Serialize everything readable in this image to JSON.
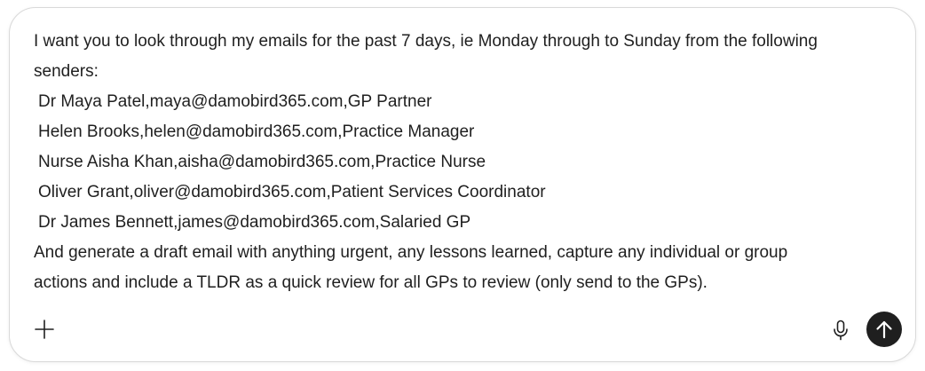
{
  "composer": {
    "prompt_lines": [
      "I want you to look through my emails for the past 7 days, ie Monday through to Sunday from the following",
      "senders:",
      "Dr Maya Patel,maya@damobird365.com,GP Partner",
      "Helen Brooks,helen@damobird365.com,Practice Manager",
      "Nurse Aisha Khan,aisha@damobird365.com,Practice Nurse",
      "Oliver Grant,oliver@damobird365.com,Patient Services Coordinator",
      "Dr James Bennett,james@damobird365.com,Salaried GP",
      "And generate a draft email with anything urgent, any lessons learned, capture any individual or group",
      "actions and include a TLDR as a quick review for all GPs to review (only send to the GPs)."
    ]
  },
  "toolbar": {
    "add_icon": "plus-icon",
    "mic_icon": "microphone-icon",
    "send_icon": "arrow-up-icon"
  },
  "colors": {
    "text": "#1f1f1f",
    "border": "#d9d9d9",
    "send_button_bg": "#1f1f1f",
    "send_icon": "#ffffff"
  }
}
